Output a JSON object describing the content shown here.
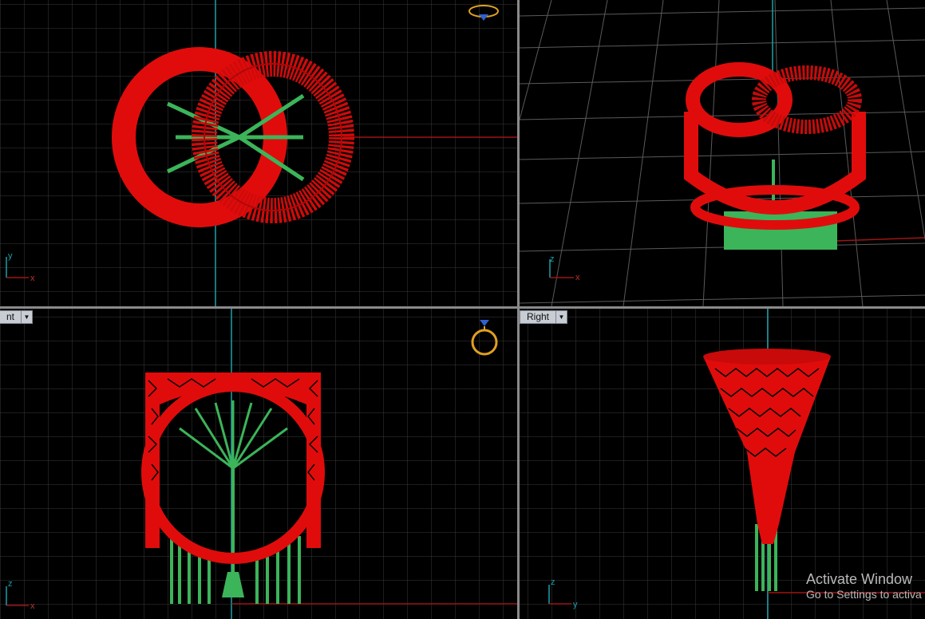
{
  "viewports": [
    {
      "id": "top",
      "label": "",
      "axis_h": "x",
      "axis_v": "y"
    },
    {
      "id": "perspective",
      "label": "",
      "axis_h": "x",
      "axis_v": "z"
    },
    {
      "id": "front",
      "label": "nt",
      "axis_h": "x",
      "axis_v": "z"
    },
    {
      "id": "right",
      "label": "Right",
      "axis_h": "y",
      "axis_v": "z"
    }
  ],
  "watermark": {
    "line1": "Activate Window",
    "line2": "Go to Settings to activa"
  },
  "colors": {
    "model": "#e00c0c",
    "support": "#3cb45a",
    "grid": "#3a3a3a",
    "grid_major": "#5a5a5a",
    "axis_x": "#a01414",
    "axis_y": "#1aa0a8",
    "ring_icon": "#e0a020",
    "gem_icon": "#3060d0"
  },
  "icons": [
    "ring-gem-icon",
    "axis-triad-icon",
    "dropdown-arrow-icon"
  ]
}
